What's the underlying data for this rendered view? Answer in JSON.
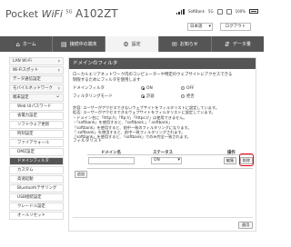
{
  "header": {
    "brand_prefix": "Pocket",
    "brand_wifi": "WiFi",
    "brand_5g": "5G",
    "model": "A102ZT",
    "network": "SoftBank",
    "network_type": "5G",
    "battery": "100%",
    "language": "日本語",
    "logout": "ログアウト"
  },
  "nav": {
    "tabs": [
      {
        "icon": "⌂",
        "label": "ホーム"
      },
      {
        "icon": "▤",
        "label": "接続中の端末"
      },
      {
        "icon": "⚙",
        "label": "設定"
      },
      {
        "icon": "✉",
        "label": "お知らせ"
      },
      {
        "icon": "⇵",
        "label": "データ量"
      }
    ]
  },
  "sidebar": {
    "items": [
      {
        "label": "LAN Wi-Fi"
      },
      {
        "label": "Wi-Fiスポット"
      },
      {
        "label": "データ通信設定"
      },
      {
        "label": "モバイルネットワーク"
      },
      {
        "label": "端末設定"
      },
      {
        "label": "Web UIパスワード"
      },
      {
        "label": "省電力設定"
      },
      {
        "label": "ソフトウェア更新"
      },
      {
        "label": "時刻設定"
      },
      {
        "label": "ファイアウォール"
      },
      {
        "label": "DMZ設定"
      },
      {
        "label": "ドメインフィルタ"
      },
      {
        "label": "カスタム"
      },
      {
        "label": "高速起動"
      },
      {
        "label": "Bluetoothテザリング"
      },
      {
        "label": "USB接続設定"
      },
      {
        "label": "クレードル設定"
      },
      {
        "label": "オールリセット"
      }
    ]
  },
  "main": {
    "title": "ドメインのフィルタ",
    "description": [
      "ローカルエリアネットワーク内のコンピューターや特定のウェブサイトにアクセスできる",
      "制限するためにフィルタを使用します"
    ],
    "filter_label": "ドメインフィルタ",
    "filter_on": "ON",
    "filter_off": "OFF",
    "mode_label": "フィルタリングモード",
    "mode_allow": "許容",
    "mode_deny": "拒否",
    "notes": [
      "許容: ユーザーがアクセスできないウェブサイトをフィルタリストに設定しています。",
      "拒否: ユーザーがアクセスできるウェブサイトをフィルタリストに設定しています。",
      "・ドメイン名に「http://」「ftp://」「https://」は使用できません。",
      "・「softbank」を使用すると、「softbank.」「.softbank」",
      "「softbank」を使用すると、前中一致のフィルタリングになります。",
      "「.softbank」を使用すると、前中一致フィルタリングされます。",
      "「softbank」を使用すると、「softbank」でのみ完全一致されます。",
      "・「ステータス」をONにすると、設定したドメインがフィルタリングの対象となります。",
      "・「ステータス」をOFFにすると、設定したドメインがフィルタリングの対象外となります。"
    ],
    "list_title": "フィルタリスト",
    "col_domain": "ドメイン名",
    "col_status": "ステータス",
    "col_ops": "操作",
    "status_value": "ON",
    "edit": "編集",
    "delete": "削除",
    "add": "追加",
    "apply": "適用"
  }
}
